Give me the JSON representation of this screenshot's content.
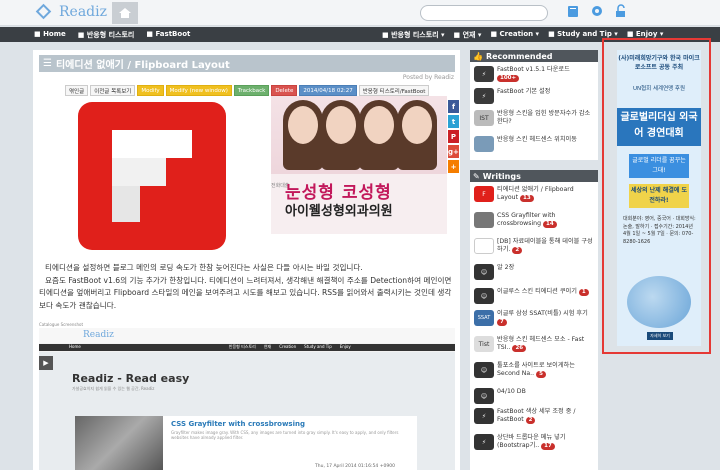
{
  "header": {
    "logo_text": "Readiz",
    "search_placeholder": ""
  },
  "nav": {
    "left": [
      "Home",
      "반응형 티스토리",
      "FastBoot"
    ],
    "right": [
      "반응형 티스토리",
      "연재",
      "Creation",
      "Study and Tip",
      "Enjoy"
    ]
  },
  "post": {
    "title": "티에디션 없애기 / Flipboard Layout",
    "posted_by": "Posted by Readiz",
    "toolbar": [
      "엮인글",
      "이전글 목록보기",
      "Modify",
      "Modify (new window)",
      "Trackback",
      "Delete",
      "2014/04/18 02:27",
      "반응형 티스토리/FastBoot"
    ],
    "ad_headline": "눈성형 코성형",
    "ad_sub": "아이웰성형외과의원",
    "ad_small": "전화대출",
    "paragraph_1": "티에디션을 설정하면 블로그 메인의 로딩 속도가 한참 늦어진다는 사실은 다들 아시는 바일 것입니다.",
    "paragraph_2": "요즘도 FastBoot v1.6의 기능 추가가 한창입니다. 티에디션이 느려터져서, 생각해낸 해결책이 주소를 Detection하여 메인이면 티에디션을 엎애버리고 Flipboard 스타일의 메인을 보여주려고 시도를 해보고 있습니다. RSS를 읽어와서 출력시키는 것인데 생각보다 속도가 괜찮습니다.",
    "caption": "Catalogue Screenshot",
    "shot": {
      "logo": "Readiz",
      "nav": [
        "Home",
        "반응형 티스토리",
        "연재",
        "Creation",
        "Study and Tip",
        "Enjoy"
      ],
      "heading": "Readiz - Read easy",
      "sub": "가설공효이지 쉽게 읽을 수 있는 웹 공간, Readiz",
      "card_title": "CSS Grayfilter with crossbrowsing",
      "card_text": "Grayfilter makes image gray. With CSS, any images are turned into gray simply. It's easy to apply, and only filters websites have already applied filter.",
      "card_date": "Thu, 17 April 2014 01:16:54 +0900"
    }
  },
  "share": [
    {
      "icon": "facebook-icon",
      "glyph": "f",
      "color": "#3b5998"
    },
    {
      "icon": "twitter-icon",
      "glyph": "t",
      "color": "#2ba1d4"
    },
    {
      "icon": "pinterest-icon",
      "glyph": "P",
      "color": "#cb2027"
    },
    {
      "icon": "google-plus-icon",
      "glyph": "g+",
      "color": "#dd4b39"
    },
    {
      "icon": "plus-icon",
      "glyph": "+",
      "color": "#f57d00"
    }
  ],
  "recommended": {
    "title": "Recommended",
    "items": [
      {
        "text": "FastBoot v1.5.1 다운로드",
        "count": "100+"
      },
      {
        "text": "FastBoot 기본 설정",
        "count": ""
      },
      {
        "text": "반응형 스킨을 입힌 방문자수가 감소한다?",
        "count": ""
      },
      {
        "text": "반응형 스킨 헤드센스 위치이동",
        "count": ""
      }
    ]
  },
  "writings": {
    "title": "Writings",
    "items": [
      {
        "text": "티에디션 없애기 / Flipboard Layout",
        "count": "13"
      },
      {
        "text": "CSS Grayfilter with crossbrowsing",
        "count": "14"
      },
      {
        "text": "[DB] 자료데이블을 통해 데이블 구성하기.",
        "count": "2"
      },
      {
        "text": "알 2장",
        "count": ""
      },
      {
        "text": "이글루스 스킨 티에디션 쿠이기",
        "count": "1"
      },
      {
        "text": "이글루 삼성 SSAT(비틀) 시험 후기",
        "count": "7"
      },
      {
        "text": "반응형 스킨 헤드센스 모소 - Fast TSI..",
        "count": "26"
      },
      {
        "text": "툴포소를 사이트로 보이게하는 Second Na..",
        "count": "5"
      },
      {
        "text": "04/10 DB",
        "count": ""
      },
      {
        "text": "FastBoot 색상 세부 조정 중 / FastBoot",
        "count": "2"
      },
      {
        "text": "상단바 드롭다운 메뉴 넣기 (Bootstrap기..",
        "count": "17"
      }
    ]
  },
  "side_ad": {
    "org": "(사)미래희망기구와 한국 마이크로소프트 공동 주최",
    "sponsor": "UN협회 세계연맹 후원",
    "headline": "글로벌리더십 외국어 경연대회",
    "cta1": "글로벌 리더를 꿈꾸는 그대!",
    "cta2": "세상의 난제 해결에 도전하라!",
    "details": "대회분야: 영어, 중국어 · 대회방식: 논술, 말하기 · 접수기간: 2014년 4월 1일 ~ 5월 7일 · 문의: 070-8280-1626",
    "button": "자세히 보기"
  }
}
